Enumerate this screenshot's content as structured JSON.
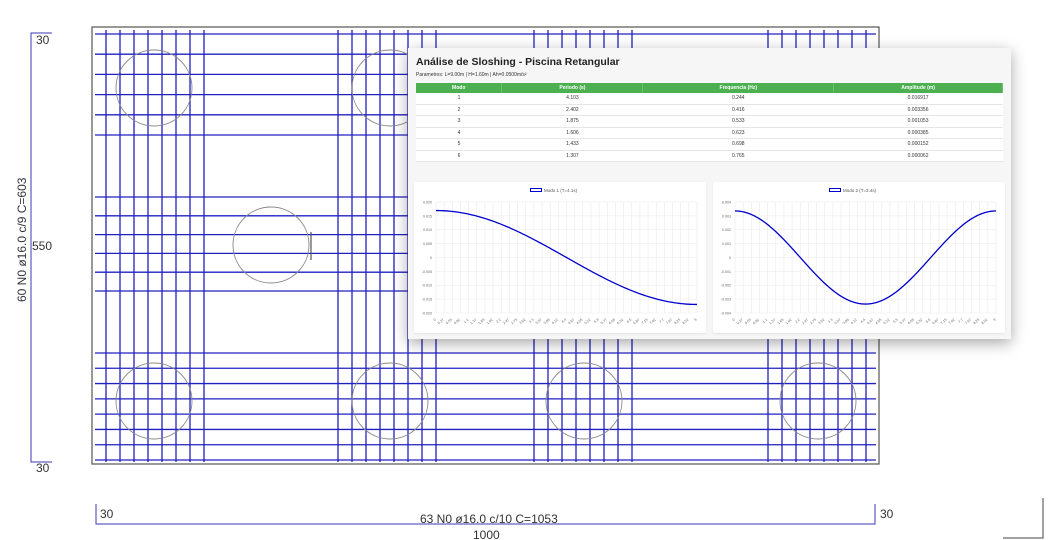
{
  "drawing": {
    "dim_left_top": "30",
    "dim_left_mid": "550",
    "dim_left_bottom": "30",
    "rebar_vertical_label": "60 N0 ø16.0 c/9 C=603",
    "dim_bottom_left": "30",
    "rebar_horizontal_label": "63 N0 ø16.0 c/10 C=1053",
    "dim_bottom_total": "1000",
    "dim_bottom_right": "30",
    "rebar_color": "#2020c0"
  },
  "panel": {
    "title": "Análise de Sloshing - Piscina Retangular",
    "params": "Parametros: L=9.00m | H=1.60m | Ah=0.0500m/s²",
    "table": {
      "headers": [
        "Modo",
        "Periodo (s)",
        "Frequencia (Hz)",
        "Amplitude (m)"
      ],
      "rows": [
        [
          "1",
          "4.103",
          "0.244",
          "0.016917"
        ],
        [
          "2",
          "2.402",
          "0.416",
          "0.003356"
        ],
        [
          "3",
          "1.875",
          "0.533",
          "0.001053"
        ],
        [
          "4",
          "1.606",
          "0.623",
          "0.000385"
        ],
        [
          "5",
          "1.433",
          "0.698",
          "0.000152"
        ],
        [
          "6",
          "1.307",
          "0.765",
          "0.000062"
        ]
      ],
      "header_color": "#4caf50"
    }
  },
  "chart_data": [
    {
      "type": "line",
      "title": "",
      "series": [
        {
          "name": "Modo 1 (T=4.1s)",
          "color": "#0000cc",
          "function": "A*cos(pi*x/L)",
          "amplitude": 0.016917
        }
      ],
      "x": [
        "0",
        "0.27",
        "0.55",
        "0.82",
        "1.1",
        "1.37",
        "1.65",
        "1.92",
        "2.2",
        "2.47",
        "2.75",
        "3.02",
        "3.3",
        "3.57",
        "3.85",
        "4.12",
        "4.4",
        "4.67",
        "4.95",
        "5.22",
        "5.5",
        "5.77",
        "6.05",
        "6.32",
        "6.6",
        "6.87",
        "7.15",
        "7.42",
        "7.7",
        "7.97",
        "8.25",
        "8.52",
        "9"
      ],
      "x_range": [
        0,
        9
      ],
      "yticks": [
        "0.020",
        "0.015",
        "0.010",
        "0.005",
        "0",
        "-0.005",
        "-0.010",
        "-0.015",
        "-0.020"
      ],
      "ylim": [
        -0.02,
        0.02
      ],
      "grid": true,
      "legend": "top"
    },
    {
      "type": "line",
      "title": "",
      "series": [
        {
          "name": "Modo 2 (T=2.4s)",
          "color": "#0000cc",
          "function": "A*cos(2*pi*x/L)",
          "amplitude": 0.003356
        }
      ],
      "x": [
        "0",
        "0.27",
        "0.55",
        "0.82",
        "1.1",
        "1.37",
        "1.65",
        "1.92",
        "2.2",
        "2.47",
        "2.75",
        "3.02",
        "3.3",
        "3.57",
        "3.85",
        "4.12",
        "4.4",
        "4.67",
        "4.95",
        "5.22",
        "5.5",
        "5.77",
        "6.05",
        "6.32",
        "6.6",
        "6.87",
        "7.15",
        "7.42",
        "7.7",
        "7.97",
        "8.25",
        "8.52",
        "9"
      ],
      "x_range": [
        0,
        9
      ],
      "yticks": [
        "0.004",
        "0.003",
        "0.002",
        "0.001",
        "0",
        "-0.001",
        "-0.002",
        "-0.003",
        "-0.004"
      ],
      "ylim": [
        -0.004,
        0.004
      ],
      "grid": true,
      "legend": "top"
    }
  ]
}
